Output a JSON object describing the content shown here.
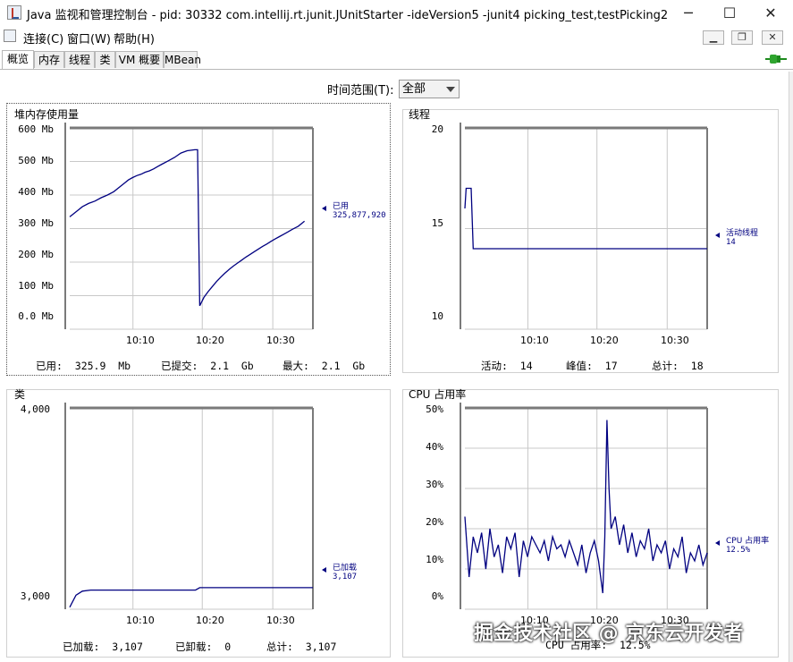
{
  "window": {
    "title": "Java 监视和管理控制台 - pid: 30332 com.intellij.rt.junit.JUnitStarter -ideVersion5 -junit4 picking_test,testPicking2",
    "minimize": "─",
    "maximize": "☐",
    "close": "✕"
  },
  "menu": {
    "items": [
      "连接(C)",
      "窗口(W)",
      "帮助(H)"
    ],
    "mdi_min": "▁",
    "mdi_restore": "❐",
    "mdi_close": "✕"
  },
  "tabs": [
    "概览",
    "内存",
    "线程",
    "类",
    "VM 概要",
    "MBean"
  ],
  "time_range": {
    "label": "时间范围(T):",
    "value": "全部"
  },
  "colors": {
    "line": "#000080",
    "plot_bg": "#ffffff",
    "grid": "#c8c8c8",
    "frame": "#7a7a7a"
  },
  "heap": {
    "title": "堆内存使用量",
    "y_ticks": [
      "600 Mb",
      "500 Mb",
      "400 Mb",
      "300 Mb",
      "200 Mb",
      "100 Mb",
      "0.0 Mb"
    ],
    "x_ticks": [
      "10:10",
      "10:20",
      "10:30"
    ],
    "legend_name": "已用",
    "legend_value": "325,877,920",
    "stats": [
      "已用:  325.9  Mb",
      "已提交:  2.1  Gb",
      "最大:  2.1  Gb"
    ]
  },
  "threads": {
    "title": "线程",
    "y_ticks": [
      "20",
      "15",
      "10"
    ],
    "x_ticks": [
      "10:10",
      "10:20",
      "10:30"
    ],
    "legend_name": "活动线程",
    "legend_value": "14",
    "stats": [
      "活动:  14",
      "峰值:  17",
      "总计:  18"
    ]
  },
  "classes": {
    "title": "类",
    "y_ticks": [
      "4,000",
      "3,000"
    ],
    "x_ticks": [
      "10:10",
      "10:20",
      "10:30"
    ],
    "legend_name": "已加载",
    "legend_value": "3,107",
    "stats": [
      "已加载:  3,107",
      "已卸载:  0",
      "总计:  3,107"
    ]
  },
  "cpu": {
    "title": "CPU 占用率",
    "y_ticks": [
      "50%",
      "40%",
      "30%",
      "20%",
      "10%",
      "0%"
    ],
    "x_ticks": [
      "10:10",
      "10:20",
      "10:30"
    ],
    "legend_name": "CPU 占用率",
    "legend_value": "12.5%",
    "stats": [
      "CPU 占用率:  12.5%"
    ]
  },
  "watermark": "掘金技术社区 @ 京东云开发者",
  "chart_data": [
    {
      "type": "line",
      "title": "堆内存使用量",
      "x_ticks": [
        "10:10",
        "10:20",
        "10:30"
      ],
      "ylim": [
        0,
        600
      ],
      "y_unit": "Mb",
      "series": [
        {
          "name": "已用",
          "x": [
            0,
            1,
            2,
            3,
            4.5,
            6,
            7.5,
            9,
            10.5,
            12,
            13,
            14,
            15,
            16,
            17,
            18,
            19,
            20,
            21,
            22,
            23.5,
            25,
            26.5,
            28,
            29.8,
            30.5,
            31,
            32,
            33,
            34,
            35,
            36,
            37,
            38,
            39,
            40,
            41,
            42,
            43,
            44,
            45,
            46,
            47,
            48,
            49,
            50,
            51,
            52,
            53,
            54.5,
            56
          ],
          "values": [
            335,
            345,
            355,
            365,
            375,
            382,
            392,
            400,
            410,
            425,
            435,
            445,
            452,
            458,
            462,
            468,
            472,
            478,
            485,
            492,
            502,
            512,
            525,
            532,
            535,
            535,
            70,
            95,
            112,
            127,
            142,
            155,
            167,
            178,
            188,
            197,
            206,
            215,
            223,
            231,
            239,
            247,
            254,
            262,
            269,
            276,
            283,
            290,
            297,
            307,
            322
          ]
        }
      ]
    },
    {
      "type": "line",
      "title": "线程",
      "x_ticks": [
        "10:10",
        "10:20",
        "10:30"
      ],
      "ylim": [
        10,
        20
      ],
      "series": [
        {
          "name": "活动线程",
          "x": [
            0,
            0.3,
            1.5,
            2,
            58
          ],
          "values": [
            16,
            17,
            17,
            14,
            14
          ]
        }
      ]
    },
    {
      "type": "line",
      "title": "类",
      "x_ticks": [
        "10:10",
        "10:20",
        "10:30"
      ],
      "ylim": [
        3000,
        4000
      ],
      "series": [
        {
          "name": "已加载",
          "x": [
            0,
            0.5,
            1.5,
            3,
            5,
            10,
            20,
            30,
            31,
            40,
            50,
            58
          ],
          "values": [
            3010,
            3030,
            3070,
            3090,
            3095,
            3095,
            3095,
            3095,
            3107,
            3107,
            3107,
            3107
          ]
        }
      ]
    },
    {
      "type": "line",
      "title": "CPU 占用率",
      "x_ticks": [
        "10:10",
        "10:20",
        "10:30"
      ],
      "ylim": [
        0,
        50
      ],
      "y_unit": "%",
      "series": [
        {
          "name": "CPU 占用率",
          "x": [
            0,
            1,
            2,
            3,
            4,
            5,
            6,
            7,
            8,
            9,
            10,
            11,
            12,
            13,
            14,
            15,
            16,
            17,
            18,
            19,
            20,
            21,
            22,
            23,
            24,
            25,
            26,
            27,
            28,
            29,
            30,
            31,
            32,
            33,
            33.5,
            34,
            34.5,
            35,
            36,
            37,
            38,
            39,
            40,
            41,
            42,
            43,
            44,
            45,
            46,
            47,
            48,
            49,
            50,
            51,
            52,
            53,
            54,
            55,
            56,
            57,
            58
          ],
          "values": [
            23,
            8,
            18,
            14,
            19,
            10,
            20,
            13,
            16,
            9,
            18,
            15,
            19,
            8,
            17,
            13,
            18,
            16,
            14,
            17,
            12,
            18,
            15,
            16,
            13,
            17,
            14,
            11,
            16,
            9,
            14,
            17,
            12,
            4,
            18,
            47,
            30,
            20,
            23,
            16,
            21,
            14,
            19,
            13,
            17,
            15,
            20,
            12,
            16,
            14,
            17,
            10,
            15,
            13,
            18,
            9,
            14,
            12,
            16,
            11,
            14
          ]
        }
      ]
    }
  ]
}
